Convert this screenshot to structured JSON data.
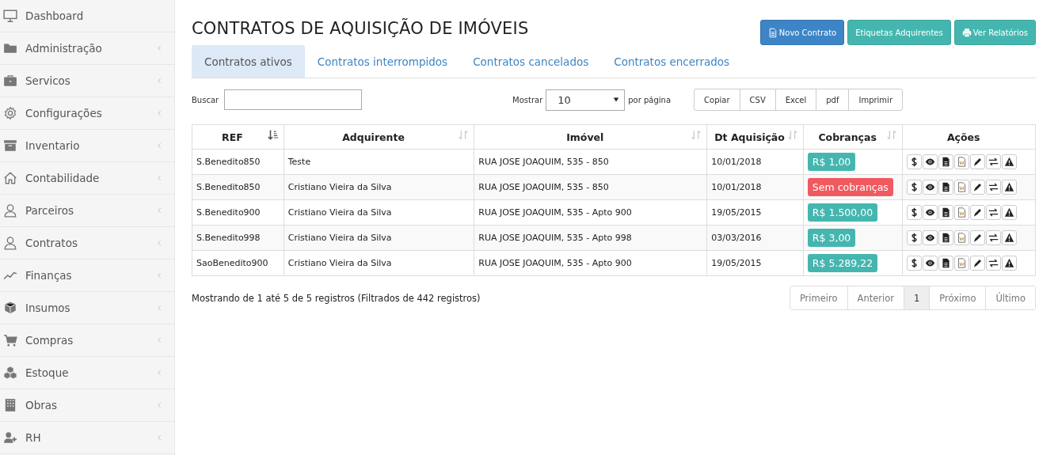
{
  "sidebar": {
    "items": [
      {
        "label": "Dashboard",
        "expandable": false
      },
      {
        "label": "Administração",
        "expandable": true
      },
      {
        "label": "Servicos",
        "expandable": true
      },
      {
        "label": "Configurações",
        "expandable": true
      },
      {
        "label": "Inventario",
        "expandable": true
      },
      {
        "label": "Contabilidade",
        "expandable": true
      },
      {
        "label": "Parceiros",
        "expandable": true
      },
      {
        "label": "Contratos",
        "expandable": true
      },
      {
        "label": "Finanças",
        "expandable": true
      },
      {
        "label": "Insumos",
        "expandable": true
      },
      {
        "label": "Compras",
        "expandable": true
      },
      {
        "label": "Estoque",
        "expandable": true
      },
      {
        "label": "Obras",
        "expandable": true
      },
      {
        "label": "RH",
        "expandable": true
      }
    ]
  },
  "page": {
    "title": "CONTRATOS DE AQUISIÇÃO DE IMÓVEIS",
    "buttons": [
      {
        "label": "Novo Contrato",
        "kind": "primary"
      },
      {
        "label": "Etiquetas Adquirentes",
        "kind": "teal"
      },
      {
        "label": "Ver Relatórios",
        "kind": "teal"
      }
    ],
    "tabs": [
      {
        "label": "Contratos ativos",
        "selected": true
      },
      {
        "label": "Contratos interrompidos",
        "selected": false
      },
      {
        "label": "Contratos cancelados",
        "selected": false
      },
      {
        "label": "Contratos encerrados",
        "selected": false
      }
    ]
  },
  "toolbar": {
    "search_label": "Buscar",
    "length_label": "Mostrar",
    "length_value": "10",
    "length_suffix": "por página",
    "export_buttons": [
      "Copiar",
      "CSV",
      "Excel",
      "pdf",
      "Imprimir"
    ]
  },
  "table": {
    "columns": [
      {
        "label": "REF",
        "kind": "sortable",
        "sorted": true
      },
      {
        "label": "Adquirente",
        "kind": "sortable",
        "sorted": false
      },
      {
        "label": "Imóvel",
        "kind": "sortable",
        "sorted": false
      },
      {
        "label": "Dt Aquisição",
        "kind": "sortable",
        "sorted": false
      },
      {
        "label": "Cobranças",
        "kind": "sortable",
        "sorted": false
      },
      {
        "label": "Ações",
        "kind": "plain"
      }
    ],
    "rows": [
      {
        "ref": "S.Benedito850",
        "adquirente": "Teste",
        "imovel": "RUA JOSE JOAQUIM, 535 - 850",
        "data": "10/01/2018",
        "cobranca": {
          "text": "R$ 1,00",
          "kind": "amount"
        }
      },
      {
        "ref": "S.Benedito850",
        "adquirente": "Cristiano Vieira da Silva",
        "imovel": "RUA JOSE JOAQUIM, 535 - 850",
        "data": "10/01/2018",
        "cobranca": {
          "text": "Sem cobranças",
          "kind": "empty"
        }
      },
      {
        "ref": "S.Benedito900",
        "adquirente": "Cristiano Vieira da Silva",
        "imovel": "RUA JOSE JOAQUIM, 535 - Apto 900",
        "data": "19/05/2015",
        "cobranca": {
          "text": "R$ 1.500,00",
          "kind": "amount"
        }
      },
      {
        "ref": "S.Benedito998",
        "adquirente": "Cristiano Vieira da Silva",
        "imovel": "RUA JOSE JOAQUIM, 535 - Apto 998",
        "data": "03/03/2016",
        "cobranca": {
          "text": "R$ 3,00",
          "kind": "amount"
        }
      },
      {
        "ref": "SaoBenedito900",
        "adquirente": "Cristiano Vieira da Silva",
        "imovel": "RUA JOSE JOAQUIM, 535 - Apto 900",
        "data": "19/05/2015",
        "cobranca": {
          "text": "R$ 5.289,22",
          "kind": "amount"
        }
      }
    ]
  },
  "footer": {
    "info": "Mostrando de 1 até 5 de 5 registros (Filtrados de 442 registros)",
    "pagination": [
      {
        "label": "Primeiro",
        "selected": false
      },
      {
        "label": "Anterior",
        "selected": false
      },
      {
        "label": "1",
        "selected": true
      },
      {
        "label": "Próximo",
        "selected": false
      },
      {
        "label": "Último",
        "selected": false
      }
    ]
  }
}
